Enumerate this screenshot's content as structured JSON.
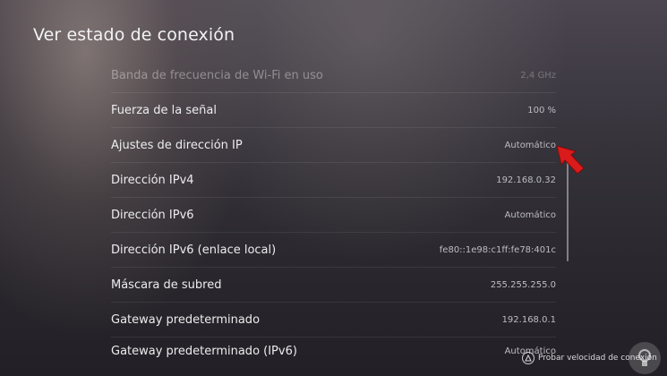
{
  "page": {
    "title": "Ver estado de conexión"
  },
  "rows": [
    {
      "label": "Banda de frecuencia de Wi-Fi en uso",
      "value": "2,4 GHz"
    },
    {
      "label": "Fuerza de la señal",
      "value": "100 %"
    },
    {
      "label": "Ajustes de dirección IP",
      "value": "Automático"
    },
    {
      "label": "Dirección IPv4",
      "value": "192.168.0.32"
    },
    {
      "label": "Dirección IPv6",
      "value": "Automático"
    },
    {
      "label": "Dirección IPv6 (enlace local)",
      "value": "fe80::1e98:c1ff:fe78:401c"
    },
    {
      "label": "Máscara de subred",
      "value": "255.255.255.0"
    },
    {
      "label": "Gateway predeterminado",
      "value": "192.168.0.1"
    },
    {
      "label": "Gateway predeterminado (IPv6)",
      "value": "Automático"
    }
  ],
  "footer": {
    "triangle_label": "Probar velocidad de conexión",
    "icon": "triangle-button-icon"
  },
  "colors": {
    "arrow": "#d91b1b",
    "background": "#2f2c33"
  }
}
